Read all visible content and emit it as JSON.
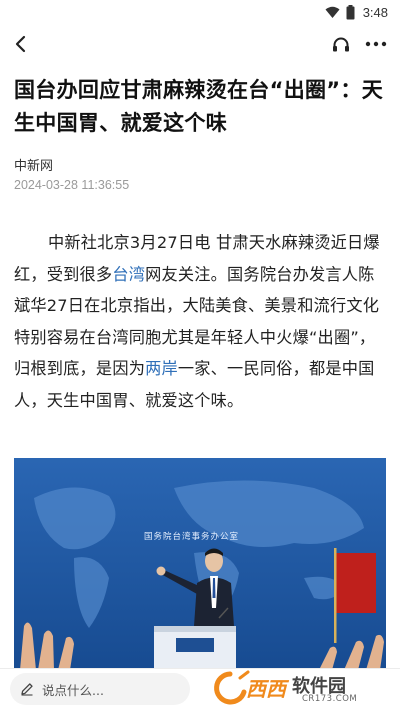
{
  "status_bar": {
    "time": "3:48"
  },
  "article": {
    "title": "国台办回应甘肃麻辣烫在台“出圈”：天生中国胃、就爱这个味",
    "source": "中新网",
    "published": "2024-03-28 11:36:55",
    "body": {
      "seg1": "中新社北京3月27日电  甘肃天水麻辣烫近日爆红，受到很多",
      "link1": "台湾",
      "seg2": "网友关注。国务院台办发言人陈斌华27日在北京指出，大陆美食、美景和流行文化特别容易在台湾同胞尤其是年轻人中火爆“出圈”，归根到底，是因为",
      "link2": "两岸",
      "seg3": "一家、一民同俗，都是中国人，天生中国胃、就爱这个味。"
    },
    "photo_banner": "国务院台湾事务办公室"
  },
  "comment": {
    "placeholder": "说点什么..."
  },
  "watermark": {
    "brand": "西西",
    "name": "软件园",
    "url": "CR173.COM"
  },
  "colors": {
    "link": "#2f6fb8",
    "photo_bg": "#1f5aa6",
    "watermark_orange": "#f08a1c"
  },
  "icons": [
    "back-icon",
    "headphones-icon",
    "more-icon",
    "wifi-icon",
    "battery-icon",
    "pencil-icon"
  ]
}
